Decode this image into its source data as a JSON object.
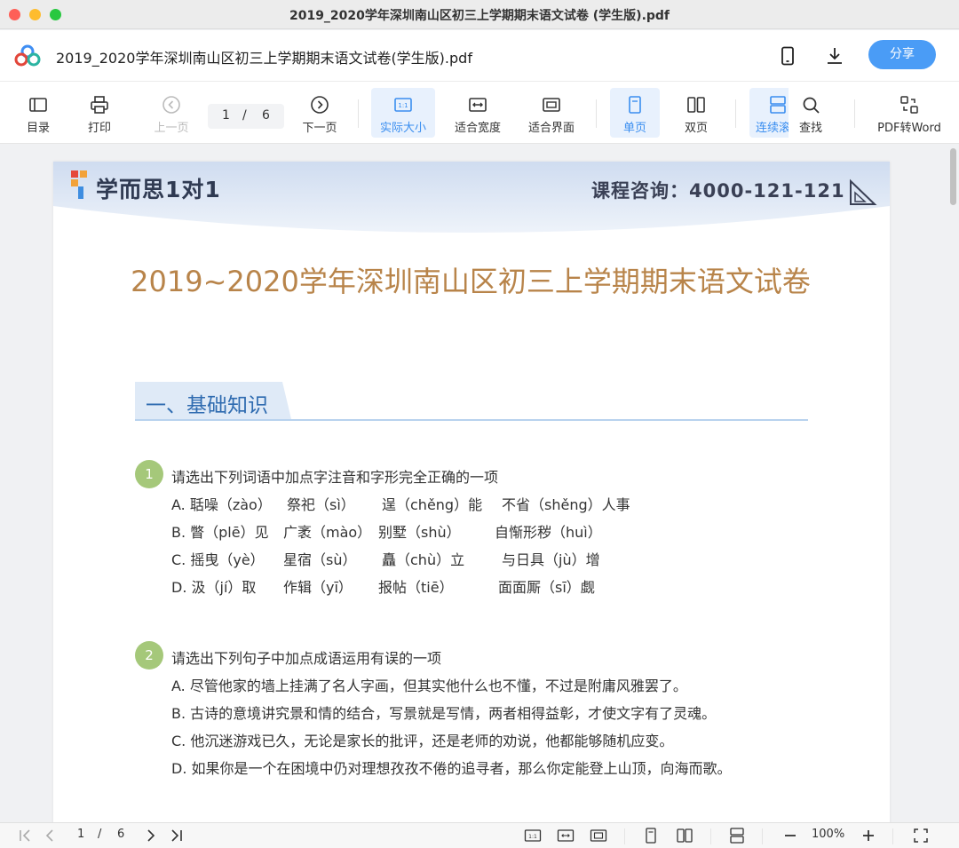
{
  "window": {
    "title": "2019_2020学年深圳南山区初三上学期期末语文试卷 (学生版).pdf"
  },
  "header": {
    "doc_name": "2019_2020学年深圳南山区初三上学期期末语文试卷(学生版).pdf",
    "share_label": "分享"
  },
  "toolbar": {
    "toc": "目录",
    "print": "打印",
    "prev": "上一页",
    "page_current": "1",
    "page_sep": "/",
    "page_total": "6",
    "next": "下一页",
    "actual_size": "实际大小",
    "fit_width": "适合宽度",
    "fit_page": "适合界面",
    "single": "单页",
    "double": "双页",
    "continuous": "连续滚",
    "find": "查找",
    "pdf_to_word": "PDF转Word"
  },
  "page": {
    "brand": "学而思1对1",
    "consult": "课程咨询：4000-121-121",
    "title": "2019~2020学年深圳南山区初三上学期期末语文试卷",
    "section": "一、基础知识",
    "q1": {
      "num": "1",
      "stem": "请选出下列词语中加点字注音和字形完全正确的一项",
      "a": [
        "A.  聒噪（zào）",
        "祭祀（sì）",
        "逞（chěng）能",
        "不省（shěng）人事"
      ],
      "b": [
        "B.  瞥（plē）见",
        "广袤（mào）",
        "别墅（shù）",
        "自惭形秽（huì）"
      ],
      "c": [
        "C.  摇曳（yè）",
        "星宿（sù）",
        "矗（chù）立",
        "与日具（jù）增"
      ],
      "d": [
        "D.  汲（jí）取",
        "作辑（yī）",
        "报帖（tiē）",
        "面面厮（sī）觑"
      ]
    },
    "q2": {
      "num": "2",
      "stem": "请选出下列句子中加点成语运用有误的一项",
      "a": "A.  尽管他家的墙上挂满了名人字画，但其实他什么也不懂，不过是附庸风雅罢了。",
      "b": "B.  古诗的意境讲究景和情的结合，写景就是写情，两者相得益彰，才使文字有了灵魂。",
      "c": "C.  他沉迷游戏已久，无论是家长的批评，还是老师的劝说，他都能够随机应变。",
      "d": "D.  如果你是一个在困境中仍对理想孜孜不倦的追寻者，那么你定能登上山顶，向海而歌。"
    }
  },
  "bottombar": {
    "page_current": "1",
    "page_sep": "/",
    "page_total": "6",
    "zoom": "100%"
  },
  "colors": {
    "accent": "#4a9cf6",
    "title": "#b8844a",
    "section": "#2e6bb0",
    "badge": "#a5c87a"
  }
}
